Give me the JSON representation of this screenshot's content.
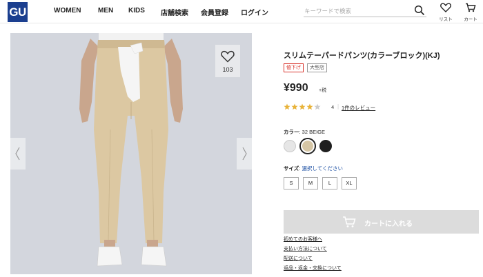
{
  "header": {
    "logo": "GU",
    "nav": [
      "WOMEN",
      "MEN",
      "KIDS",
      "店舗検索",
      "会員登録",
      "ログイン"
    ],
    "search_placeholder": "キーワードで検索",
    "list_label": "リスト",
    "cart_label": "カート"
  },
  "image": {
    "favorite_count": "103"
  },
  "product": {
    "title": "スリムテーパードパンツ(カラーブロック)(KJ)",
    "badges": [
      "値下げ",
      "大型店"
    ],
    "price": "¥990",
    "tax": "+税",
    "rating_value": "4",
    "rating_stars": 4,
    "rating_max": 5,
    "review_link": "1件のレビュー",
    "color_label": "カラー",
    "color_value": ": 32 BEIGE",
    "size_label": "サイズ",
    "size_value": "選択してください",
    "sizes": [
      "S",
      "M",
      "L",
      "XL"
    ],
    "cart_button": "カートに入れる",
    "links": [
      "初めてのお客様へ",
      "支払い方法について",
      "配送について",
      "返品・返金・交換について"
    ]
  },
  "colors": {
    "brand": "#1b3f8f",
    "sale": "#d9332b",
    "star_on": "#e8b33a",
    "star_off": "#cccccc",
    "swatches": [
      "#e6e6e6",
      "#d6c6a5",
      "#1f1f1f"
    ]
  }
}
